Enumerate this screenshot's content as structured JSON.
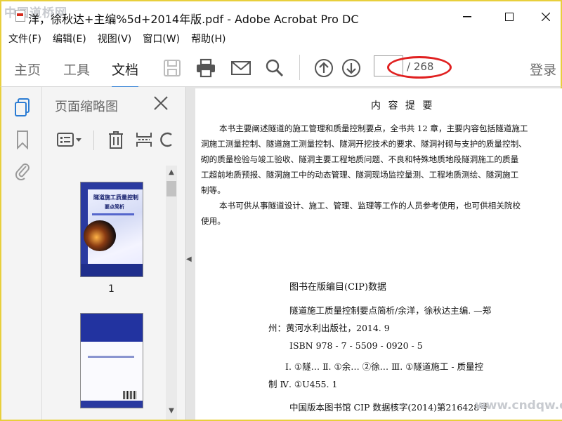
{
  "window": {
    "title": "洋，徐秋达+主编%5d+2014年版.pdf - Adobe Acrobat Pro DC",
    "watermark_top": "中国道桥网",
    "watermark_bottom": "www.cndqw.com"
  },
  "menu": [
    "文件(F)",
    "编辑(E)",
    "视图(V)",
    "窗口(W)",
    "帮助(H)"
  ],
  "toolbar": {
    "tabs": [
      "主页",
      "工具",
      "文档"
    ],
    "active_tab": "文档",
    "page_current": "",
    "page_total": "/ 268",
    "login": "登录"
  },
  "panel": {
    "title": "页面缩略图",
    "thumbnails": [
      {
        "label": "1",
        "cover_title": "隧道施工质量控制",
        "cover_subtitle": "要点简析"
      }
    ]
  },
  "document": {
    "heading": "内 容 提 要",
    "paragraphs": [
      "本书主要阐述隧道的施工管理和质量控制要点，全书共 12 章，主要内容包括隧道施工",
      "洞施工测量控制、隧道施工测量控制、隧洞开挖技术的要求、隧洞衬砌与支护的质量控制、",
      "砌的质量检验与竣工验收、隧洞主要工程地质问题、不良和特殊地质地段隧洞施工的质量",
      "工超前地质预报、隧洞施工中的动态管理、隧洞现场监控量测、工程地质测绘、隧洞施工",
      "制等。",
      "本书可供从事隧道设计、施工、管理、监理等工作的人员参考使用，也可供相关院校",
      "使用。"
    ],
    "cip_title": "图书在版编目(CIP)数据",
    "cip_lines": [
      "隧道施工质量控制要点简析/余洋，徐秋达主编. —郑",
      "州：黄河水利出版社，2014. 9",
      "ISBN 978 - 7 - 5509 - 0920 - 5"
    ],
    "cip_lines2": [
      "Ⅰ. ①隧… Ⅱ. ①余… ②徐… Ⅲ. ①隧道施工 - 质量控",
      "制 Ⅳ. ①U455. 1"
    ],
    "cip_line3": "中国版本图书馆 CIP 数据核字(2014)第216428号"
  }
}
